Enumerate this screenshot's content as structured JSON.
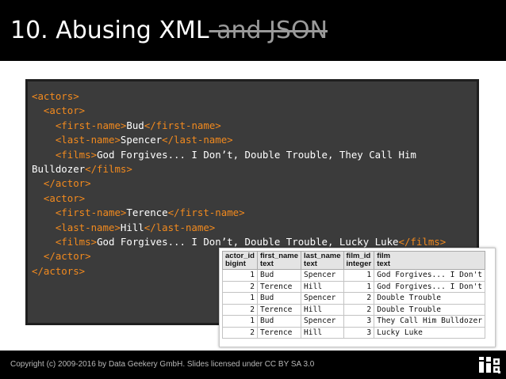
{
  "slide": {
    "title_main": "10. Abusing XML",
    "title_strike": " and JSON",
    "footer_text": "Copyright (c) 2009-2016 by Data Geekery GmbH. Slides licensed under CC BY SA 3.0"
  },
  "xml_lines": [
    [
      {
        "t": "tag",
        "v": "<actors>"
      }
    ],
    [
      {
        "t": "text",
        "v": "  "
      },
      {
        "t": "tag",
        "v": "<actor>"
      }
    ],
    [
      {
        "t": "text",
        "v": "    "
      },
      {
        "t": "tag",
        "v": "<first-name>"
      },
      {
        "t": "text",
        "v": "Bud"
      },
      {
        "t": "tag",
        "v": "</first-name>"
      }
    ],
    [
      {
        "t": "text",
        "v": "    "
      },
      {
        "t": "tag",
        "v": "<last-name>"
      },
      {
        "t": "text",
        "v": "Spencer"
      },
      {
        "t": "tag",
        "v": "</last-name>"
      }
    ],
    [
      {
        "t": "text",
        "v": "    "
      },
      {
        "t": "tag",
        "v": "<films>"
      },
      {
        "t": "text",
        "v": "God Forgives... I Don’t, Double Trouble, They Call Him"
      }
    ],
    [
      {
        "t": "text",
        "v": "Bulldozer"
      },
      {
        "t": "tag",
        "v": "</films>"
      }
    ],
    [
      {
        "t": "text",
        "v": "  "
      },
      {
        "t": "tag",
        "v": "</actor>"
      }
    ],
    [
      {
        "t": "text",
        "v": "  "
      },
      {
        "t": "tag",
        "v": "<actor>"
      }
    ],
    [
      {
        "t": "text",
        "v": "    "
      },
      {
        "t": "tag",
        "v": "<first-name>"
      },
      {
        "t": "text",
        "v": "Terence"
      },
      {
        "t": "tag",
        "v": "</first-name>"
      }
    ],
    [
      {
        "t": "text",
        "v": "    "
      },
      {
        "t": "tag",
        "v": "<last-name>"
      },
      {
        "t": "text",
        "v": "Hill"
      },
      {
        "t": "tag",
        "v": "</last-name>"
      }
    ],
    [
      {
        "t": "text",
        "v": "    "
      },
      {
        "t": "tag",
        "v": "<films>"
      },
      {
        "t": "text",
        "v": "God Forgives... I Don’t, Double Trouble, Lucky Luke"
      },
      {
        "t": "tag",
        "v": "</films>"
      }
    ],
    [
      {
        "t": "text",
        "v": "  "
      },
      {
        "t": "tag",
        "v": "</actor>"
      }
    ],
    [
      {
        "t": "tag",
        "v": "</actors>"
      }
    ]
  ],
  "table": {
    "columns": [
      {
        "name": "actor_id",
        "type": "bigint"
      },
      {
        "name": "first_name",
        "type": "text"
      },
      {
        "name": "last_name",
        "type": "text"
      },
      {
        "name": "film_id",
        "type": "integer"
      },
      {
        "name": "film",
        "type": "text"
      }
    ],
    "rows": [
      [
        "1",
        "Bud",
        "Spencer",
        "1",
        "God Forgives... I Don't"
      ],
      [
        "2",
        "Terence",
        "Hill",
        "1",
        "God Forgives... I Don't"
      ],
      [
        "1",
        "Bud",
        "Spencer",
        "2",
        "Double Trouble"
      ],
      [
        "2",
        "Terence",
        "Hill",
        "2",
        "Double Trouble"
      ],
      [
        "1",
        "Bud",
        "Spencer",
        "3",
        "They Call Him Bulldozer"
      ],
      [
        "2",
        "Terence",
        "Hill",
        "3",
        "Lucky Luke"
      ]
    ]
  },
  "colors": {
    "tag": "#f28a1e",
    "code_bg": "#3b3b3b",
    "bar_bg": "#000000"
  },
  "icons": {
    "logo": "jooq-logo-icon"
  }
}
